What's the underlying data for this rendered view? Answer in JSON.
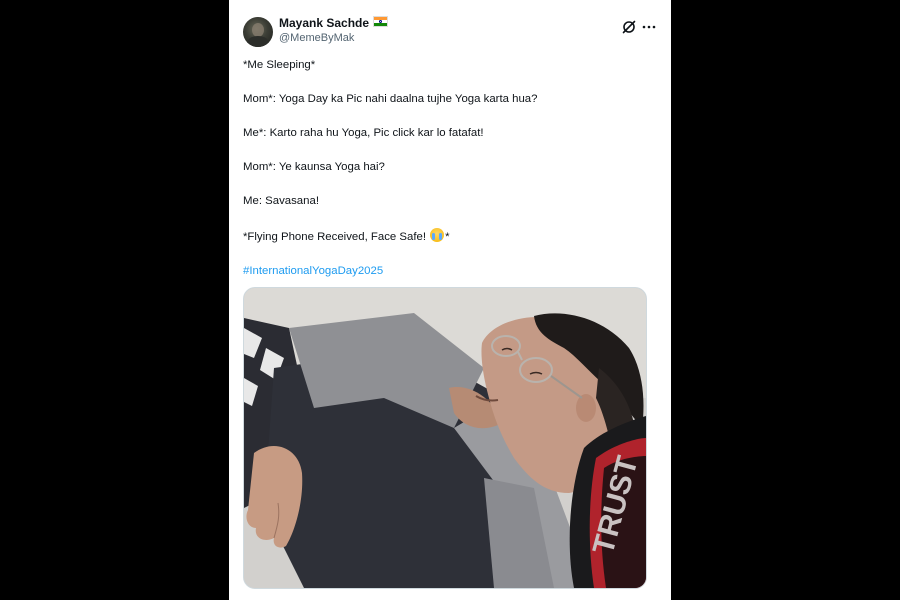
{
  "author": {
    "display_name": "Mayank Sachde",
    "handle": "@MemeByMak",
    "flag_icon": "india-flag-icon"
  },
  "header_icons": [
    "grok-icon",
    "more-options-icon"
  ],
  "tweet": {
    "lines": [
      "*Me Sleeping*",
      "Mom*: Yoga Day ka Pic nahi daalna tujhe Yoga karta hua?",
      "Me*: Karto raha hu Yoga, Pic click kar lo fatafat!",
      "Mom*: Ye kaunsa Yoga hai?",
      "Me: Savasana!"
    ],
    "last_line_prefix": "*Flying Phone Received, Face Safe! ",
    "last_line_emoji": "loudly-crying-face-emoji",
    "last_line_suffix": "*",
    "hashtag": "#InternationalYogaDay2025"
  },
  "media": {
    "pillow_text": "TRUST"
  },
  "colors": {
    "link": "#1d9bf0",
    "text": "#0f1419",
    "secondary_text": "#536471",
    "background": "#000000",
    "card": "#ffffff"
  }
}
